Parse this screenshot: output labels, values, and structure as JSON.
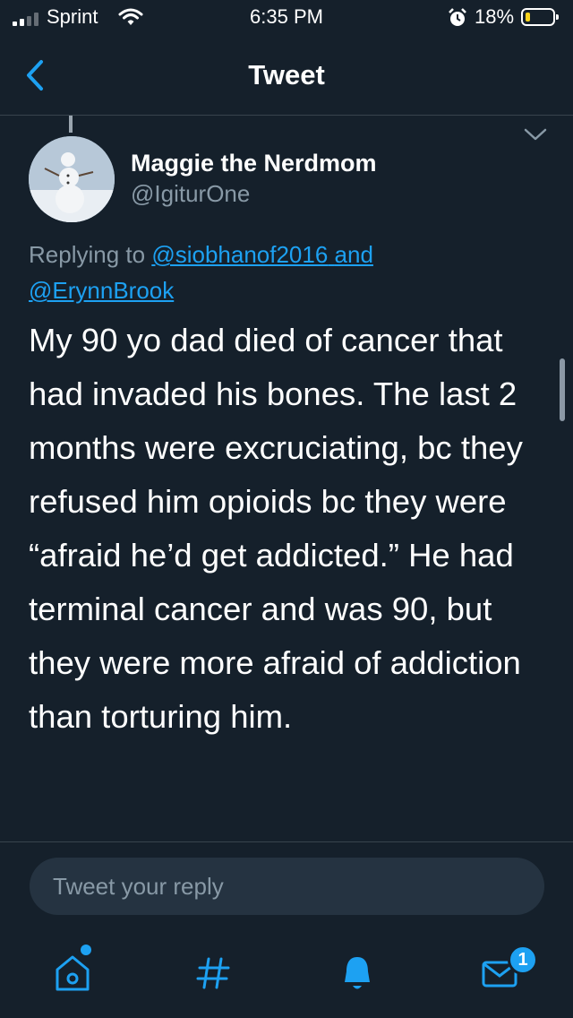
{
  "status_bar": {
    "carrier": "Sprint",
    "time": "6:35 PM",
    "battery_percent": "18%",
    "battery_level": 0.18,
    "signal_bars": 2
  },
  "nav": {
    "title": "Tweet",
    "back_icon": "chevron-left-icon"
  },
  "tweet": {
    "author_name": "Maggie the Nerdmom",
    "author_handle": "@IgiturOne",
    "replying_prefix": "Replying to",
    "reply_to_1": "@siobhanof2016",
    "reply_conjunction": "and",
    "reply_to_2": "@ErynnBrook",
    "body": "My 90 yo dad died of cancer that had invaded his bones. The last 2 months were excruciating, bc they refused him opioids bc they were “afraid he’d get addicted.”  He had terminal cancer and was 90, but they were more afraid of addiction than torturing him."
  },
  "reply_box": {
    "placeholder": "Tweet your reply"
  },
  "tab_bar": {
    "items": [
      {
        "name": "home",
        "icon": "home-icon",
        "has_dot": true
      },
      {
        "name": "explore",
        "icon": "hashtag-icon"
      },
      {
        "name": "notifications",
        "icon": "bell-icon",
        "active": true
      },
      {
        "name": "messages",
        "icon": "envelope-icon",
        "badge": "1"
      }
    ]
  },
  "colors": {
    "background": "#15202b",
    "accent": "#1da1f2",
    "secondary_text": "#8899a6",
    "battery_low": "#f8d21c"
  }
}
